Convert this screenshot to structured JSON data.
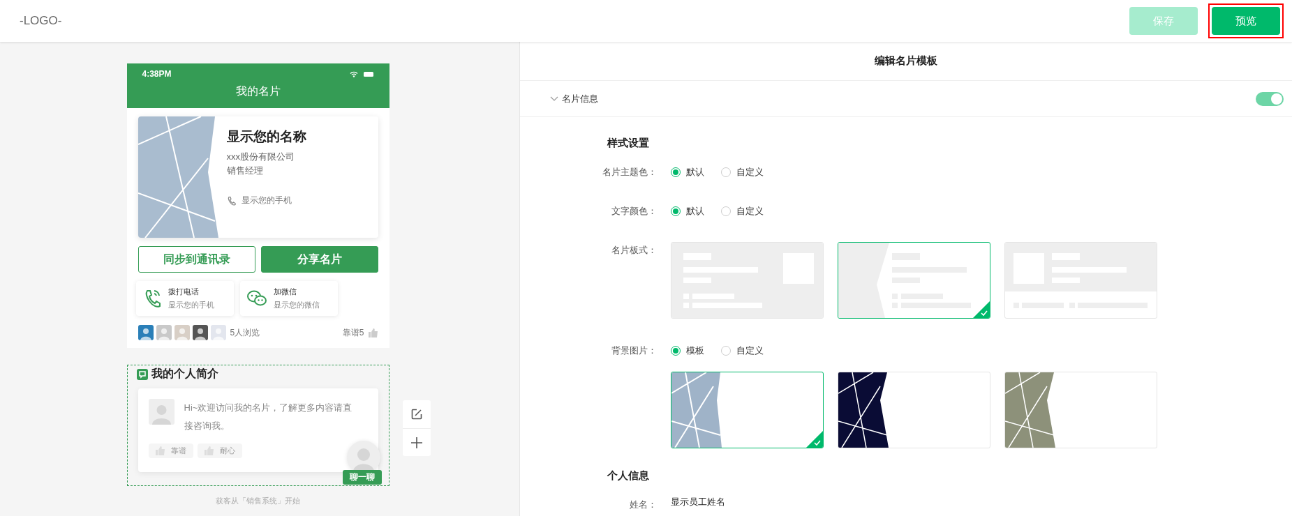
{
  "header": {
    "logo": "-LOGO-",
    "buttons": [
      {
        "label": "保存",
        "disabled": true,
        "highlighted": false
      },
      {
        "label": "预览",
        "disabled": false,
        "highlighted": true
      }
    ]
  },
  "phone": {
    "status_time": "4:38PM",
    "title": "我的名片",
    "card": {
      "name": "显示您的名称",
      "company": "xxx股份有限公司",
      "position": "销售经理",
      "phone": "显示您的手机"
    },
    "actions": [
      {
        "label": "同步到通讯录",
        "kind": "outline"
      },
      {
        "label": "分享名片",
        "kind": "filled"
      }
    ],
    "contacts": [
      {
        "kind": "phone",
        "title": "拨打电话",
        "value": "显示您的手机"
      },
      {
        "kind": "wechat",
        "title": "加微信",
        "value": "显示您的微信"
      }
    ],
    "views": "5人浏览",
    "likes": "靠谱5",
    "intro": {
      "title": "我的个人简介",
      "selected": true,
      "text": "Hi~欢迎访问我的名片，了解更多内容请直接咨询我。",
      "tags": [
        "靠谱",
        "耐心"
      ],
      "chat": "聊一聊"
    },
    "footer": "获客从「销售系统」开始"
  },
  "editor": {
    "title": "编辑名片模板",
    "section": {
      "label": "名片信息",
      "expanded": true,
      "on": true
    },
    "style_heading": "样式设置",
    "rows": [
      {
        "kind": "radio",
        "label": "名片主题色：",
        "options": [
          {
            "label": "默认",
            "selected": true
          },
          {
            "label": "自定义",
            "selected": false
          }
        ]
      },
      {
        "kind": "radio",
        "label": "文字颜色：",
        "options": [
          {
            "label": "默认",
            "selected": true
          },
          {
            "label": "自定义",
            "selected": false
          }
        ]
      },
      {
        "kind": "layouts",
        "label": "名片板式：",
        "options": [
          {
            "kind": "image-right",
            "selected": false
          },
          {
            "kind": "slant-left",
            "selected": true
          },
          {
            "kind": "image-top",
            "selected": false
          }
        ]
      },
      {
        "kind": "radio",
        "label": "背景图片：",
        "options": [
          {
            "label": "模板",
            "selected": true
          },
          {
            "label": "自定义",
            "selected": false
          }
        ]
      },
      {
        "kind": "backgrounds",
        "options": [
          {
            "kind": "building",
            "selected": true
          },
          {
            "kind": "network",
            "selected": false
          },
          {
            "kind": "money",
            "selected": false
          }
        ]
      }
    ],
    "personal_heading": "个人信息",
    "fields": [
      {
        "label": "姓名：",
        "value": "显示员工姓名"
      }
    ]
  }
}
